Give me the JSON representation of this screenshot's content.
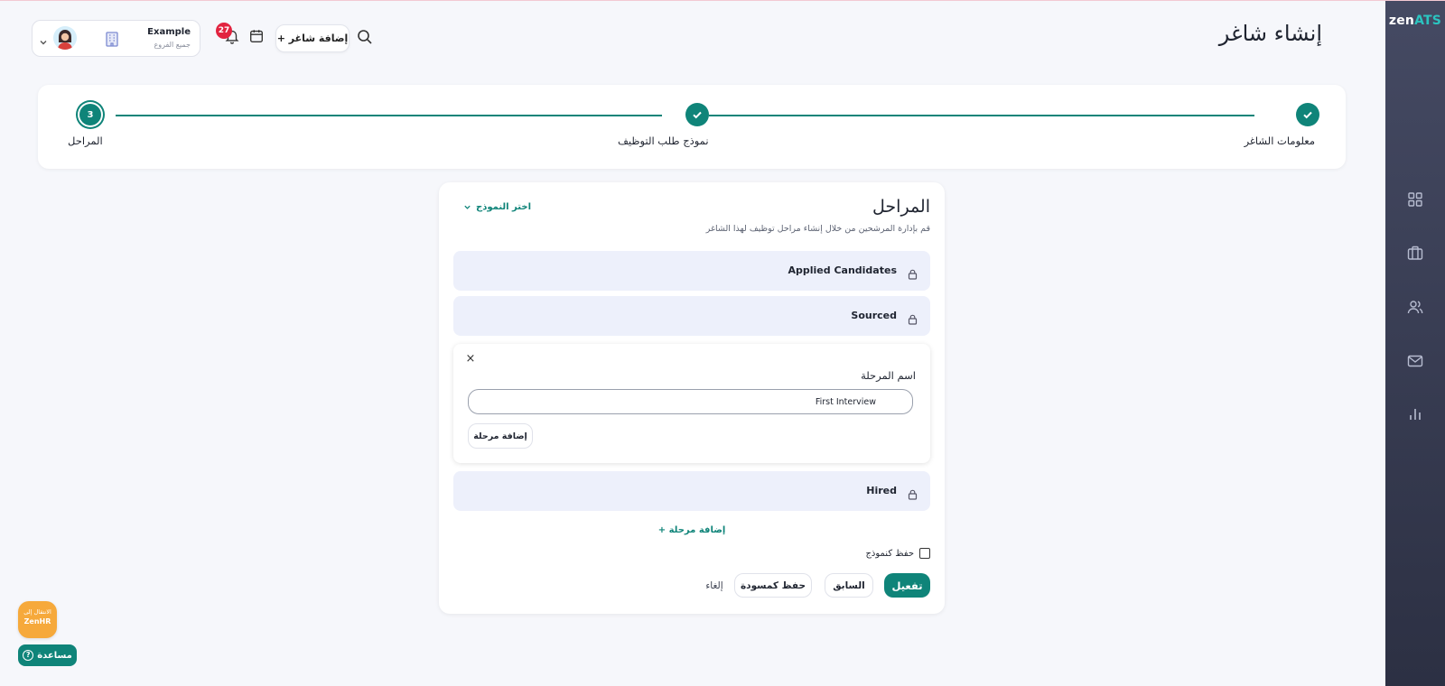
{
  "app": {
    "logo_part1": "zen",
    "logo_part2": "ATS"
  },
  "sidebar": {
    "items": [
      {
        "icon": "dashboard-grid-icon"
      },
      {
        "icon": "briefcase-icon"
      },
      {
        "icon": "users-icon"
      },
      {
        "icon": "mail-icon"
      },
      {
        "icon": "bar-chart-icon"
      }
    ]
  },
  "header": {
    "title": "إنشاء شاغر",
    "add_job_label": "+ إضافة شاغر",
    "notifications_count": "27",
    "user_name": "Example",
    "user_branch": "جميع الفروع"
  },
  "stepper": {
    "steps": [
      {
        "label": "معلومات الشاغر",
        "state": "done"
      },
      {
        "label": "نموذج طلب التوظيف",
        "state": "done"
      },
      {
        "label": "المراحل",
        "number": "3",
        "state": "current"
      }
    ]
  },
  "stages_card": {
    "title": "المراحل",
    "template_select": "اختر النموذج",
    "description": "قم بإدارة المرشحين من خلال إنشاء مراحل توظيف لهذا الشاغر",
    "stages": [
      {
        "name": "Applied Candidates",
        "locked": true
      },
      {
        "name": "Sourced",
        "locked": true
      },
      {
        "name": "Hired",
        "locked": true
      }
    ],
    "edit_panel": {
      "close": "×",
      "field_label": "اسم المرحلة",
      "field_value": "First Interview",
      "add_button": "إضافة مرحلة"
    },
    "add_stage_link": "+ إضافة مرحلة",
    "save_as_template": "حفظ كنموذج",
    "buttons": {
      "activate": "تفعيل",
      "previous": "السابق",
      "save_draft": "حفظ كمسودة",
      "cancel": "إلغاء"
    }
  },
  "floating": {
    "zenhr_line1": "الانتقال إلى",
    "zenhr_line2": "ZenHR",
    "help": "مساعدة",
    "help_icon": "?"
  },
  "colors": {
    "primary": "#0f8479",
    "sidebar": "#3a3e54",
    "badge": "#e2233f",
    "zenhr": "#f6a93b",
    "stage_bg": "#edf0fb"
  }
}
